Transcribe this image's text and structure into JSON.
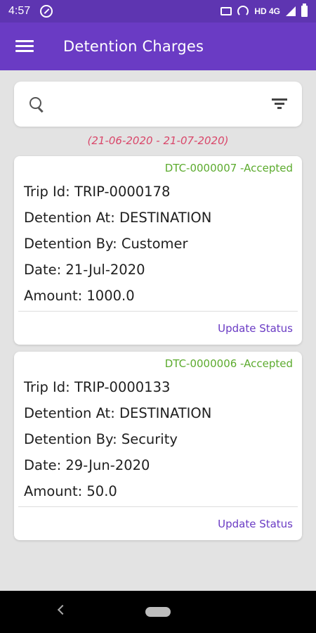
{
  "status_bar": {
    "time": "4:57",
    "network_text": "HD 4G",
    "icons": [
      "blocked-icon",
      "vibrate-icon",
      "hotspot-icon",
      "signal-icon",
      "battery-icon"
    ]
  },
  "app_bar": {
    "title": "Detention Charges",
    "menu_icon": "hamburger-icon",
    "color": "#6a3bc4"
  },
  "search": {
    "placeholder": "",
    "value": "",
    "search_icon": "search-icon",
    "filter_icon": "filter-icon"
  },
  "date_range": "(21-06-2020 - 21-07-2020)",
  "cards": [
    {
      "status": "DTC-0000007 -Accepted",
      "trip": "Trip Id: TRIP-0000178",
      "detention_at": "Detention At: DESTINATION",
      "detention_by": "Detention By: Customer",
      "date": "Date: 21-Jul-2020",
      "amount": "Amount: 1000.0",
      "action": "Update Status"
    },
    {
      "status": "DTC-0000006 -Accepted",
      "trip": "Trip Id: TRIP-0000133",
      "detention_at": "Detention At: DESTINATION",
      "detention_by": "Detention By: Security",
      "date": "Date: 29-Jun-2020",
      "amount": "Amount: 50.0",
      "action": "Update Status"
    }
  ],
  "colors": {
    "accent": "#6a3bc4",
    "status_accepted": "#5cab2e",
    "date_range": "#d9476a"
  }
}
